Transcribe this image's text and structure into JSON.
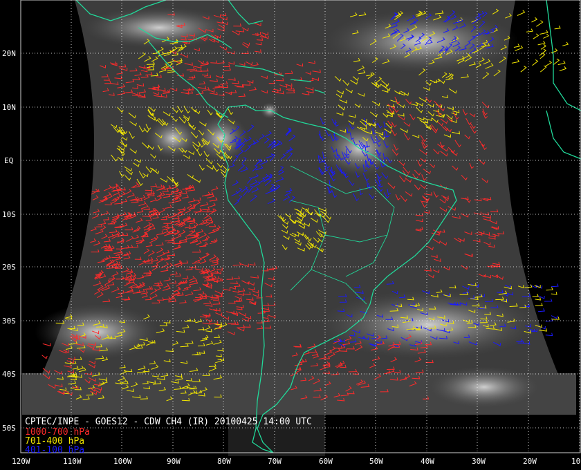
{
  "map": {
    "caption": "CPTEC/INPE - GOES12 - CDW CH4 (IR) 20100425 14:00 UTC",
    "legend": [
      {
        "label": "1000-700 hPa",
        "color": "#ff2b2b"
      },
      {
        "label": "701-400 hPa",
        "color": "#f2e600"
      },
      {
        "label": "401-100 hPa",
        "color": "#1a1aff"
      }
    ],
    "coastline_color": "#21d99a",
    "grid_color": "#ffffff",
    "lat_labels": [
      "20N",
      "10N",
      "EQ",
      "10S",
      "20S",
      "30S",
      "40S",
      "50S"
    ],
    "lon_labels": [
      "120W",
      "110W",
      "100W",
      "90W",
      "80W",
      "70W",
      "60W",
      "50W",
      "40W",
      "30W",
      "20W",
      "10"
    ]
  }
}
